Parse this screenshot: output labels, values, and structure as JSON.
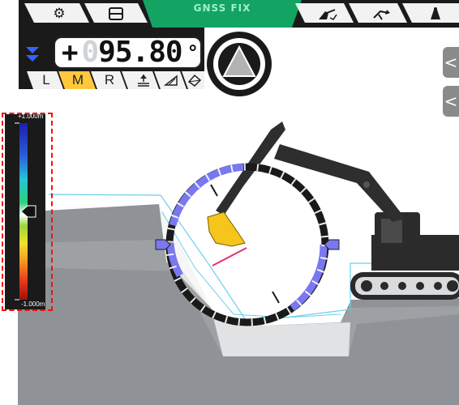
{
  "header": {
    "status_label": "GNSS FIX",
    "tabs_left": [
      {
        "icon": "gear-icon"
      },
      {
        "icon": "split-view-icon"
      }
    ],
    "tabs_right": [
      {
        "icon": "excavator-dig-icon"
      },
      {
        "icon": "boom-arm-icon"
      },
      {
        "icon": "operator-icon"
      }
    ]
  },
  "readout": {
    "sign": "+",
    "ghost_digit": "0",
    "value": "95.80",
    "unit": "°"
  },
  "mode_buttons": [
    {
      "label": "L",
      "active": false
    },
    {
      "label": "M",
      "active": true
    },
    {
      "label": "R",
      "active": false
    }
  ],
  "tool_buttons": [
    {
      "icon": "level-target-icon"
    },
    {
      "icon": "slope-icon"
    },
    {
      "icon": "plane-icon"
    }
  ],
  "side_buttons": [
    {
      "label": "<"
    },
    {
      "label": "<"
    }
  ],
  "depth_scale": {
    "top_label": "+1.000m",
    "bottom_label": "-1.000m",
    "indicator_fraction": 0.5
  },
  "colors": {
    "accent_green": "#13a363",
    "bar_dark": "#1a1a1a",
    "mode_active": "#ffc83d",
    "ring_blue": "#7a78f0",
    "bucket_yellow": "#f5c51b",
    "terrain_gray": "#8f9296",
    "design_line": "#6ad0ee",
    "highlight_red": "#ee1111"
  }
}
